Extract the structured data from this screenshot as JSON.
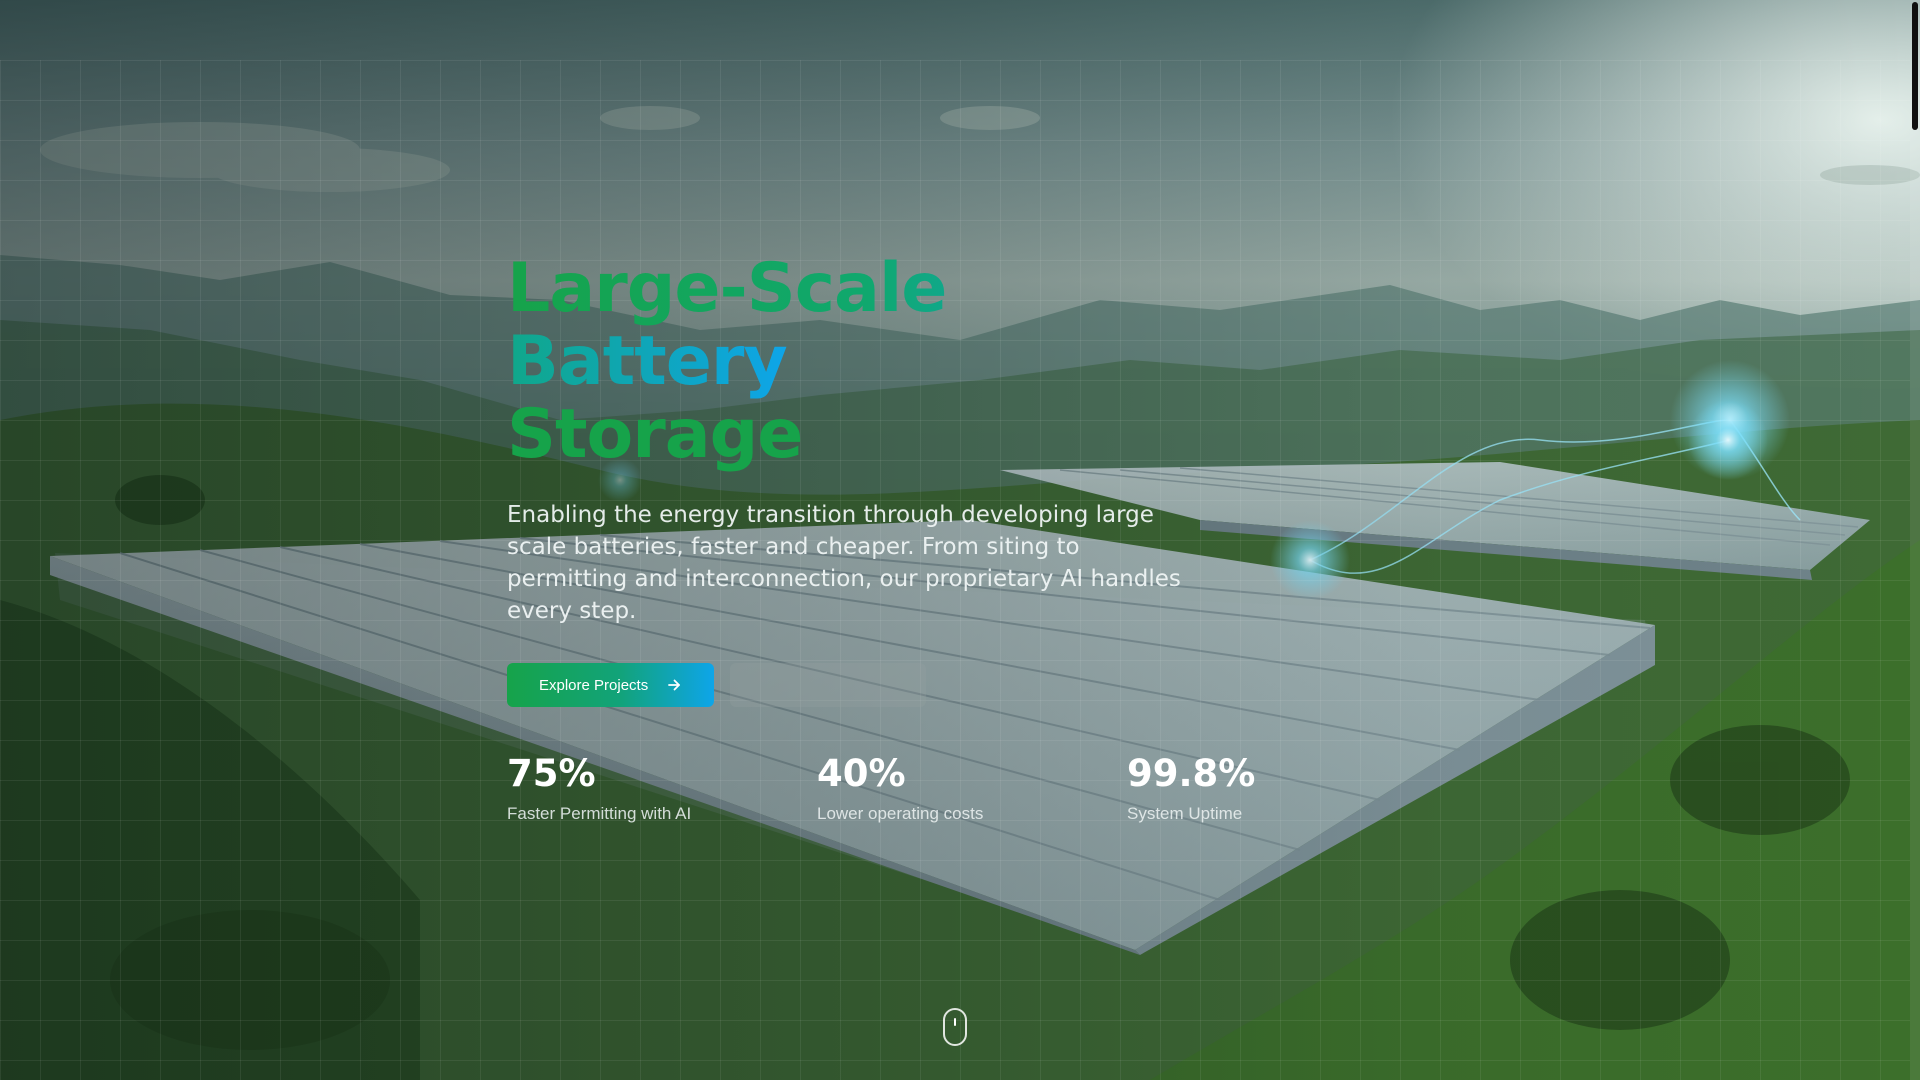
{
  "hero": {
    "title_line1": "Large-Scale Battery",
    "title_line2": "Storage",
    "subtitle": "Enabling the energy transition through developing large scale batteries, faster and cheaper. From siting to permitting and interconnection, our proprietary AI handles every step.",
    "primary_button": {
      "label": "Explore Projects",
      "icon": "arrow-right-icon"
    },
    "secondary_button": {
      "label": ""
    }
  },
  "stats": [
    {
      "value": "75%",
      "label": "Faster Permitting with AI"
    },
    {
      "value": "40%",
      "label": "Lower operating costs"
    },
    {
      "value": "99.8%",
      "label": "System Uptime"
    }
  ],
  "scroll_indicator": {
    "icon": "mouse-scroll-icon"
  },
  "colors": {
    "accent_green": "#16a34a",
    "accent_blue": "#0ea5e9",
    "text_white": "#ffffff"
  }
}
